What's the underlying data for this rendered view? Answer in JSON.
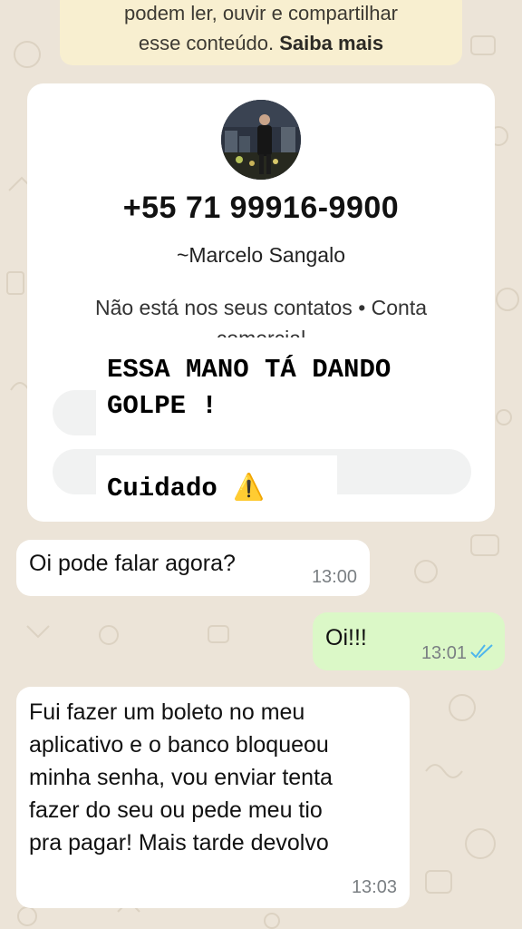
{
  "notice": {
    "line1": "podem ler, ouvir e compartilhar",
    "line2_prefix": "esse conteúdo.",
    "link": "Saiba mais"
  },
  "contact": {
    "phone": "+55 71 99916-9900",
    "pushname": "~Marcelo Sangalo",
    "status_line1": "Não está nos seus contatos • Conta",
    "status_line2": "comercial"
  },
  "overlay": {
    "caption1_line1": "ESSA MANO TÁ DANDO",
    "caption1_line2": "GOLPE !",
    "caption2": "Cuidado",
    "caption2_emoji": "⚠️"
  },
  "messages": [
    {
      "direction": "incoming",
      "text": "Oi pode falar agora?",
      "time": "13:00"
    },
    {
      "direction": "outgoing",
      "text": "Oi!!!",
      "time": "13:01",
      "status": "read-double-check-icon"
    },
    {
      "direction": "incoming",
      "lines": [
        "Fui fazer um boleto no meu",
        "aplicativo e o banco bloqueou",
        "minha senha, vou enviar tenta",
        "fazer do seu ou pede meu tio",
        "pra pagar! Mais tarde devolvo"
      ],
      "time": "13:03"
    }
  ],
  "colors": {
    "wallpaper": "#ece4d8",
    "notice_bg": "#f8efd0",
    "outgoing_bubble": "#dbf8c7",
    "incoming_bubble": "#ffffff",
    "read_ticks": "#4fb6ec",
    "warning": "#f2b400"
  }
}
